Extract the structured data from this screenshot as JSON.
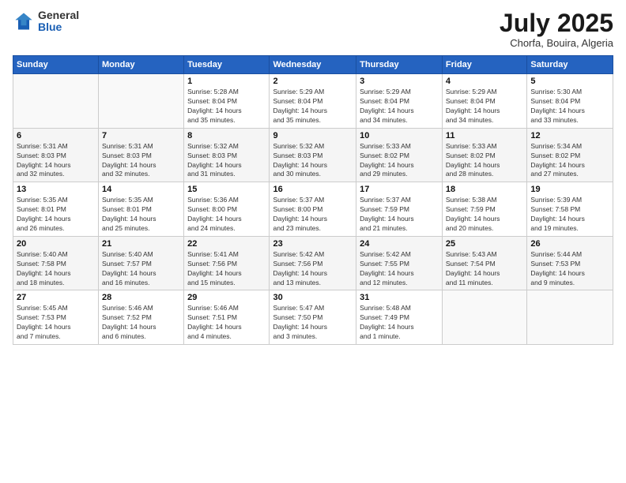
{
  "logo": {
    "general": "General",
    "blue": "Blue"
  },
  "title": "July 2025",
  "subtitle": "Chorfa, Bouira, Algeria",
  "headers": [
    "Sunday",
    "Monday",
    "Tuesday",
    "Wednesday",
    "Thursday",
    "Friday",
    "Saturday"
  ],
  "weeks": [
    [
      {
        "day": "",
        "info": ""
      },
      {
        "day": "",
        "info": ""
      },
      {
        "day": "1",
        "info": "Sunrise: 5:28 AM\nSunset: 8:04 PM\nDaylight: 14 hours\nand 35 minutes."
      },
      {
        "day": "2",
        "info": "Sunrise: 5:29 AM\nSunset: 8:04 PM\nDaylight: 14 hours\nand 35 minutes."
      },
      {
        "day": "3",
        "info": "Sunrise: 5:29 AM\nSunset: 8:04 PM\nDaylight: 14 hours\nand 34 minutes."
      },
      {
        "day": "4",
        "info": "Sunrise: 5:29 AM\nSunset: 8:04 PM\nDaylight: 14 hours\nand 34 minutes."
      },
      {
        "day": "5",
        "info": "Sunrise: 5:30 AM\nSunset: 8:04 PM\nDaylight: 14 hours\nand 33 minutes."
      }
    ],
    [
      {
        "day": "6",
        "info": "Sunrise: 5:31 AM\nSunset: 8:03 PM\nDaylight: 14 hours\nand 32 minutes."
      },
      {
        "day": "7",
        "info": "Sunrise: 5:31 AM\nSunset: 8:03 PM\nDaylight: 14 hours\nand 32 minutes."
      },
      {
        "day": "8",
        "info": "Sunrise: 5:32 AM\nSunset: 8:03 PM\nDaylight: 14 hours\nand 31 minutes."
      },
      {
        "day": "9",
        "info": "Sunrise: 5:32 AM\nSunset: 8:03 PM\nDaylight: 14 hours\nand 30 minutes."
      },
      {
        "day": "10",
        "info": "Sunrise: 5:33 AM\nSunset: 8:02 PM\nDaylight: 14 hours\nand 29 minutes."
      },
      {
        "day": "11",
        "info": "Sunrise: 5:33 AM\nSunset: 8:02 PM\nDaylight: 14 hours\nand 28 minutes."
      },
      {
        "day": "12",
        "info": "Sunrise: 5:34 AM\nSunset: 8:02 PM\nDaylight: 14 hours\nand 27 minutes."
      }
    ],
    [
      {
        "day": "13",
        "info": "Sunrise: 5:35 AM\nSunset: 8:01 PM\nDaylight: 14 hours\nand 26 minutes."
      },
      {
        "day": "14",
        "info": "Sunrise: 5:35 AM\nSunset: 8:01 PM\nDaylight: 14 hours\nand 25 minutes."
      },
      {
        "day": "15",
        "info": "Sunrise: 5:36 AM\nSunset: 8:00 PM\nDaylight: 14 hours\nand 24 minutes."
      },
      {
        "day": "16",
        "info": "Sunrise: 5:37 AM\nSunset: 8:00 PM\nDaylight: 14 hours\nand 23 minutes."
      },
      {
        "day": "17",
        "info": "Sunrise: 5:37 AM\nSunset: 7:59 PM\nDaylight: 14 hours\nand 21 minutes."
      },
      {
        "day": "18",
        "info": "Sunrise: 5:38 AM\nSunset: 7:59 PM\nDaylight: 14 hours\nand 20 minutes."
      },
      {
        "day": "19",
        "info": "Sunrise: 5:39 AM\nSunset: 7:58 PM\nDaylight: 14 hours\nand 19 minutes."
      }
    ],
    [
      {
        "day": "20",
        "info": "Sunrise: 5:40 AM\nSunset: 7:58 PM\nDaylight: 14 hours\nand 18 minutes."
      },
      {
        "day": "21",
        "info": "Sunrise: 5:40 AM\nSunset: 7:57 PM\nDaylight: 14 hours\nand 16 minutes."
      },
      {
        "day": "22",
        "info": "Sunrise: 5:41 AM\nSunset: 7:56 PM\nDaylight: 14 hours\nand 15 minutes."
      },
      {
        "day": "23",
        "info": "Sunrise: 5:42 AM\nSunset: 7:56 PM\nDaylight: 14 hours\nand 13 minutes."
      },
      {
        "day": "24",
        "info": "Sunrise: 5:42 AM\nSunset: 7:55 PM\nDaylight: 14 hours\nand 12 minutes."
      },
      {
        "day": "25",
        "info": "Sunrise: 5:43 AM\nSunset: 7:54 PM\nDaylight: 14 hours\nand 11 minutes."
      },
      {
        "day": "26",
        "info": "Sunrise: 5:44 AM\nSunset: 7:53 PM\nDaylight: 14 hours\nand 9 minutes."
      }
    ],
    [
      {
        "day": "27",
        "info": "Sunrise: 5:45 AM\nSunset: 7:53 PM\nDaylight: 14 hours\nand 7 minutes."
      },
      {
        "day": "28",
        "info": "Sunrise: 5:46 AM\nSunset: 7:52 PM\nDaylight: 14 hours\nand 6 minutes."
      },
      {
        "day": "29",
        "info": "Sunrise: 5:46 AM\nSunset: 7:51 PM\nDaylight: 14 hours\nand 4 minutes."
      },
      {
        "day": "30",
        "info": "Sunrise: 5:47 AM\nSunset: 7:50 PM\nDaylight: 14 hours\nand 3 minutes."
      },
      {
        "day": "31",
        "info": "Sunrise: 5:48 AM\nSunset: 7:49 PM\nDaylight: 14 hours\nand 1 minute."
      },
      {
        "day": "",
        "info": ""
      },
      {
        "day": "",
        "info": ""
      }
    ]
  ]
}
